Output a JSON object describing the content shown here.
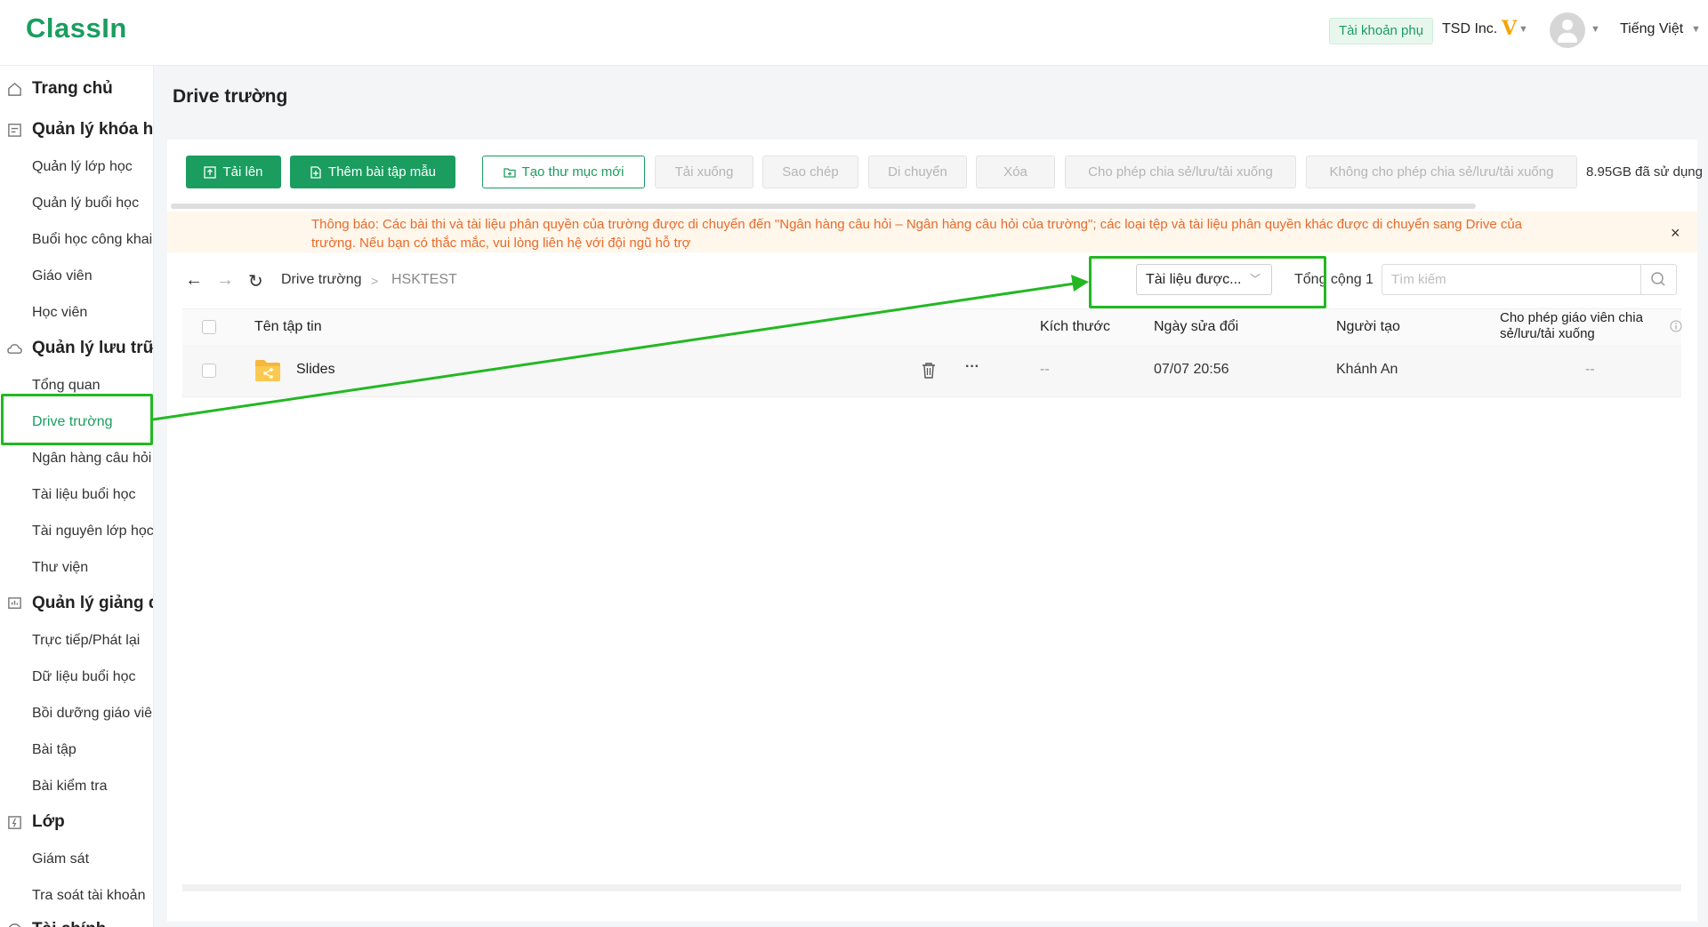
{
  "header": {
    "logo": "ClassIn",
    "account_badge": "Tài khoản phụ",
    "org_name": "TSD Inc.",
    "vip_mark": "V",
    "language": "Tiếng Việt"
  },
  "sidebar": {
    "groups": [
      {
        "label": "Trang chủ",
        "icon": "home-icon",
        "items": []
      },
      {
        "label": "Quản lý khóa học",
        "icon": "course-icon",
        "items": [
          "Quản lý lớp học",
          "Quản lý buổi học",
          "Buổi học công khai",
          "Giáo viên",
          "Học viên"
        ]
      },
      {
        "label": "Quản lý lưu trữ",
        "icon": "cloud-icon",
        "items": [
          "Tổng quan",
          "Drive trường",
          "Ngân hàng câu hỏi",
          "Tài liệu buổi học",
          "Tài nguyên lớp học",
          "Thư viện"
        ]
      },
      {
        "label": "Quản lý giảng dạy",
        "icon": "teaching-icon",
        "items": [
          "Trực tiếp/Phát lại",
          "Dữ liệu buổi học",
          "Bồi dưỡng giáo viên",
          "Bài tập",
          "Bài kiểm tra"
        ]
      },
      {
        "label": "Lớp",
        "icon": "class-icon",
        "items": [
          "Giám sát",
          "Tra soát tài khoản"
        ]
      },
      {
        "label": "Tài chính",
        "icon": "finance-icon",
        "items": []
      }
    ],
    "active_item": "Drive trường"
  },
  "page": {
    "title": "Drive trường"
  },
  "toolbar": {
    "upload": "Tải lên",
    "add_template": "Thêm bài tập mẫu",
    "new_folder": "Tạo thư mục mới",
    "download": "Tải xuống",
    "copy": "Sao chép",
    "move": "Di chuyển",
    "delete": "Xóa",
    "allow_share": "Cho phép chia sẻ/lưu/tải xuống",
    "disallow_share": "Không cho phép chia sẻ/lưu/tải xuống",
    "storage_used": "8.95GB đã sử dụng"
  },
  "notice": {
    "text": "Thông báo: Các bài thi và tài liệu phân quyền của trường được di chuyển đến \"Ngân hàng câu hỏi – Ngân hàng câu hỏi của trường\"; các loại tệp và tài liệu phân quyền khác được di chuyển sang Drive của trường. Nếu bạn có thắc mắc, vui lòng liên hệ với đội ngũ hỗ trợ",
    "close": "×"
  },
  "browser": {
    "breadcrumb_root": "Drive trường",
    "breadcrumb_separator": ">",
    "breadcrumb_current": "HSKTEST",
    "filter_value": "Tài liệu được...",
    "total": "Tổng cộng 1",
    "search_placeholder": "Tìm kiếm"
  },
  "table": {
    "columns": [
      "Tên tập tin",
      "Kích thước",
      "Ngày sửa đổi",
      "Người tạo",
      "Cho phép giáo viên chia sẻ/lưu/tải xuống"
    ],
    "rows": [
      {
        "name": "Slides",
        "size": "--",
        "modified": "07/07 20:56",
        "creator": "Khánh An",
        "share": "--",
        "more": "···"
      }
    ]
  },
  "colors": {
    "brand": "#1a9d5f",
    "notice": "#e86a2a",
    "highlight": "#22b822"
  }
}
